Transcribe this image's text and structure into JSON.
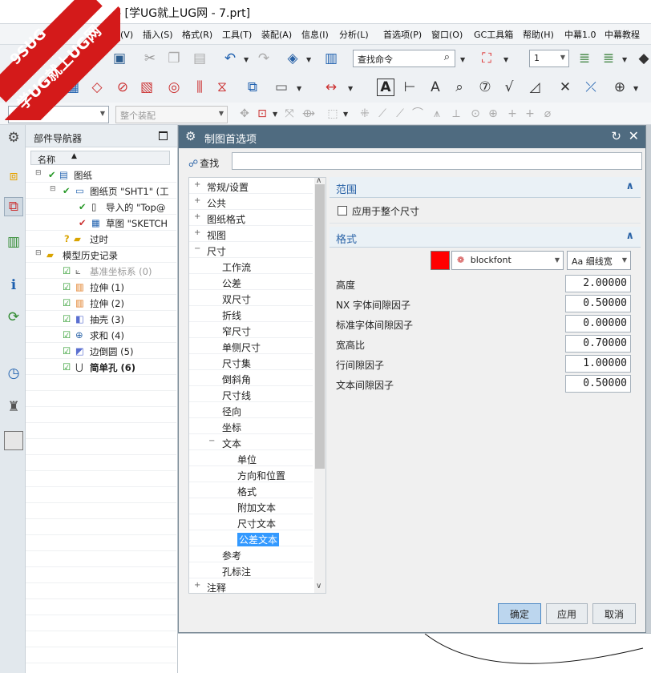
{
  "window": {
    "title": "- [学UG就上UG网 - 7.prt]"
  },
  "logo": {
    "line1": "9SUG",
    "line2": "学UG就上UG网"
  },
  "menu": [
    "视图(V)",
    "插入(S)",
    "格式(R)",
    "工具(T)",
    "装配(A)",
    "信息(I)",
    "分析(L)",
    "首选项(P)",
    "窗口(O)",
    "GC工具箱",
    "帮助(H)",
    "中幕1.0",
    "中幕教程"
  ],
  "toolbar": {
    "find_command_placeholder": "查找命令",
    "layer_value": "1",
    "filter_value": "",
    "assembly_filter": "整个装配"
  },
  "navigator": {
    "title": "部件导航器",
    "col_name": "名称",
    "rows": [
      {
        "label": "图纸"
      },
      {
        "label": "图纸页 \"SHT1\" (工"
      },
      {
        "label": "导入的 \"Top@"
      },
      {
        "label": "草图 \"SKETCH"
      },
      {
        "label": "过时"
      },
      {
        "label": "模型历史记录"
      },
      {
        "label": "基准坐标系 (0)"
      },
      {
        "label": "拉伸 (1)"
      },
      {
        "label": "拉伸 (2)"
      },
      {
        "label": "抽壳 (3)"
      },
      {
        "label": "求和 (4)"
      },
      {
        "label": "边倒圆 (5)"
      },
      {
        "label": "简单孔 (6)"
      }
    ]
  },
  "dialog": {
    "title": "制图首选项",
    "find_label": "查找",
    "tree": [
      {
        "label": "常规/设置",
        "toggle": "+"
      },
      {
        "label": "公共",
        "toggle": "+"
      },
      {
        "label": "图纸格式",
        "toggle": "+"
      },
      {
        "label": "视图",
        "toggle": "+"
      },
      {
        "label": "尺寸",
        "toggle": "−"
      },
      {
        "label": "工作流"
      },
      {
        "label": "公差"
      },
      {
        "label": "双尺寸"
      },
      {
        "label": "折线"
      },
      {
        "label": "窄尺寸"
      },
      {
        "label": "单侧尺寸"
      },
      {
        "label": "尺寸集"
      },
      {
        "label": "倒斜角"
      },
      {
        "label": "尺寸线"
      },
      {
        "label": "径向"
      },
      {
        "label": "坐标"
      },
      {
        "label": "文本",
        "toggle": "−"
      },
      {
        "label": "单位"
      },
      {
        "label": "方向和位置"
      },
      {
        "label": "格式"
      },
      {
        "label": "附加文本"
      },
      {
        "label": "尺寸文本"
      },
      {
        "label": "公差文本"
      },
      {
        "label": "参考"
      },
      {
        "label": "孔标注"
      },
      {
        "label": "注释",
        "toggle": "+"
      }
    ],
    "scope": {
      "title": "范围",
      "apply_all_label": "应用于整个尺寸"
    },
    "format": {
      "title": "格式",
      "color": "#ff0000",
      "font": "blockfont",
      "width": "Aa 细线宽",
      "fields": [
        {
          "label": "高度",
          "value": "2.00000"
        },
        {
          "label": "NX 字体间隙因子",
          "value": "0.50000"
        },
        {
          "label": "标准字体间隙因子",
          "value": "0.00000"
        },
        {
          "label": "宽高比",
          "value": "0.70000"
        },
        {
          "label": "行间隙因子",
          "value": "1.00000"
        },
        {
          "label": "文本间隙因子",
          "value": "0.50000"
        }
      ]
    },
    "buttons": {
      "ok": "确定",
      "apply": "应用",
      "cancel": "取消"
    }
  }
}
